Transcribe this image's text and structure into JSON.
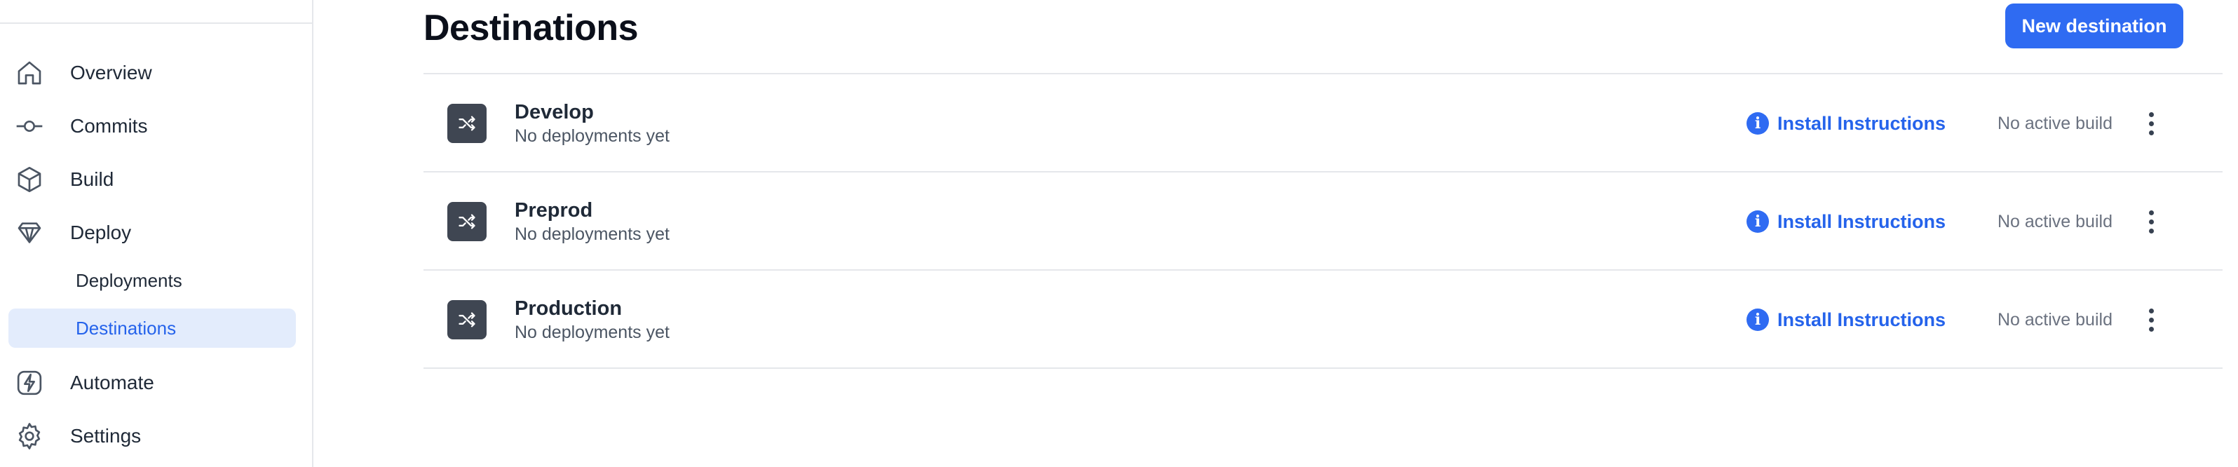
{
  "sidebar": {
    "items": [
      {
        "label": "Overview",
        "icon": "home-icon"
      },
      {
        "label": "Commits",
        "icon": "commit-icon"
      },
      {
        "label": "Build",
        "icon": "cube-icon"
      },
      {
        "label": "Deploy",
        "icon": "diamond-icon"
      },
      {
        "label": "Automate",
        "icon": "lightning-icon"
      },
      {
        "label": "Settings",
        "icon": "gear-icon"
      }
    ],
    "deploy_sub_items": [
      {
        "label": "Deployments",
        "active": false
      },
      {
        "label": "Destinations",
        "active": true
      }
    ]
  },
  "main": {
    "title": "Destinations",
    "new_button_label": "New destination",
    "destinations": [
      {
        "name": "Develop",
        "status": "No deployments yet",
        "install_label": "Install Instructions",
        "build_status": "No active build",
        "icon": "shuffle-icon"
      },
      {
        "name": "Preprod",
        "status": "No deployments yet",
        "install_label": "Install Instructions",
        "build_status": "No active build",
        "icon": "shuffle-icon"
      },
      {
        "name": "Production",
        "status": "No deployments yet",
        "install_label": "Install Instructions",
        "build_status": "No active build",
        "icon": "shuffle-icon"
      }
    ]
  },
  "colors": {
    "accent": "#2f6bf2",
    "active_bg": "#e3ecfc",
    "icon_tile": "#3f4652"
  }
}
